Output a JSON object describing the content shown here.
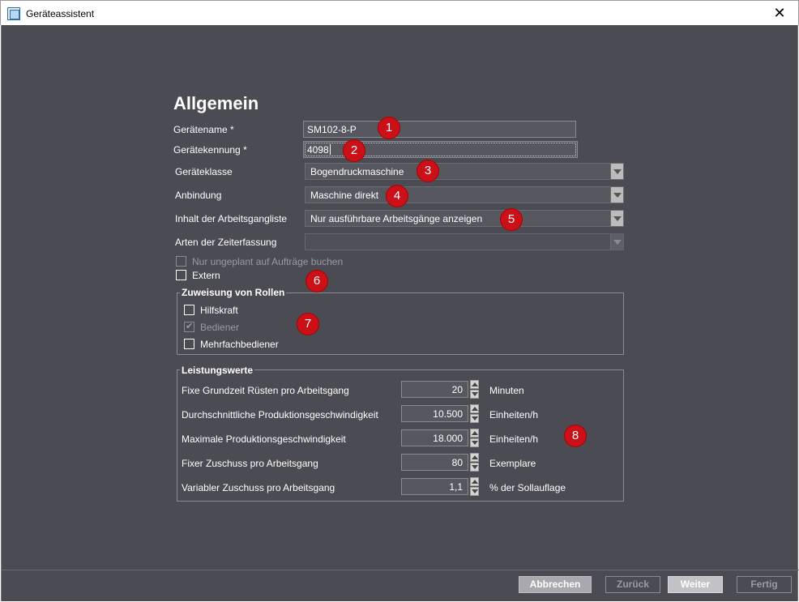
{
  "window": {
    "title": "Geräteassistent",
    "close_glyph": "✕"
  },
  "page": {
    "heading": "Allgemein"
  },
  "form": {
    "device_name": {
      "label": "Gerätename *",
      "value": "SM102-8-P"
    },
    "device_id": {
      "label": "Gerätekennung *",
      "value": "4098"
    },
    "device_class": {
      "label": "Geräteklasse",
      "value": "Bogendruckmaschine"
    },
    "connection": {
      "label": "Anbindung",
      "value": "Maschine direkt"
    },
    "worklist_content": {
      "label": "Inhalt der Arbeitsgangliste",
      "value": "Nur ausführbare Arbeitsgänge anzeigen"
    },
    "time_recording": {
      "label": "Arten der Zeiterfassung",
      "value": ""
    },
    "unplanned_booking": {
      "label": "Nur ungeplant auf Aufträge buchen",
      "checked": false,
      "enabled": false
    },
    "external": {
      "label": "Extern",
      "checked": false,
      "enabled": true
    }
  },
  "roles": {
    "title": "Zuweisung von Rollen",
    "items": [
      {
        "label": "Hilfskraft",
        "checked": false,
        "enabled": true
      },
      {
        "label": "Bediener",
        "checked": true,
        "enabled": false
      },
      {
        "label": "Mehrfachbediener",
        "checked": false,
        "enabled": true
      }
    ]
  },
  "performance": {
    "title": "Leistungswerte",
    "rows": [
      {
        "label": "Fixe Grundzeit Rüsten pro Arbeitsgang",
        "value": "20",
        "unit": "Minuten"
      },
      {
        "label": "Durchschnittliche Produktionsgeschwindigkeit",
        "value": "10.500",
        "unit": "Einheiten/h"
      },
      {
        "label": "Maximale Produktionsgeschwindigkeit",
        "value": "18.000",
        "unit": "Einheiten/h"
      },
      {
        "label": "Fixer Zuschuss pro Arbeitsgang",
        "value": "80",
        "unit": "Exemplare"
      },
      {
        "label": "Variabler Zuschuss pro Arbeitsgang",
        "value": "1,1",
        "unit": "% der Sollauflage"
      }
    ]
  },
  "badges": [
    "1",
    "2",
    "3",
    "4",
    "5",
    "6",
    "7",
    "8"
  ],
  "footer": {
    "cancel": "Abbrechen",
    "back": "Zurück",
    "next": "Weiter",
    "finish": "Fertig"
  },
  "colors": {
    "background": "#4b4b53",
    "badge": "#cc1018",
    "field": "#57575f"
  }
}
